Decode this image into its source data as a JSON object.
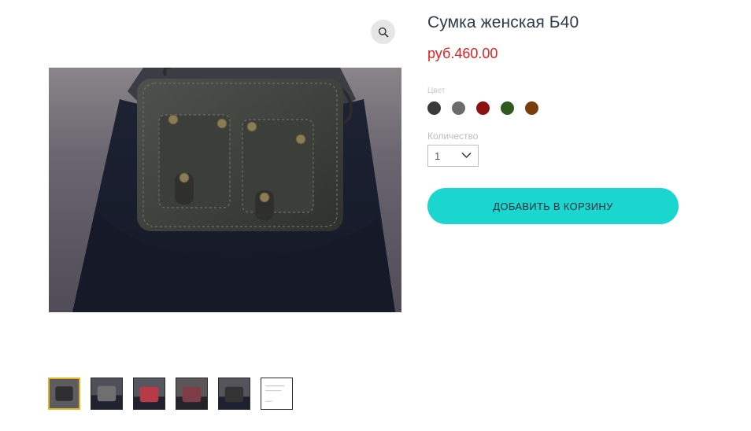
{
  "gallery": {
    "zoom_icon": "magnifier-icon",
    "thumbnails": [
      {
        "name": "thumb-black-bag",
        "selected": true,
        "bag_color": "#2f2f2f"
      },
      {
        "name": "thumb-gray-bag",
        "selected": false,
        "bag_color": "#6f6f6f"
      },
      {
        "name": "thumb-red-bag",
        "selected": false,
        "bag_color": "#b73a46"
      },
      {
        "name": "thumb-wine-bag",
        "selected": false,
        "bag_color": "#7e3c46"
      },
      {
        "name": "thumb-black-bag-2",
        "selected": false,
        "bag_color": "#333333"
      },
      {
        "name": "thumb-size-chart",
        "selected": false,
        "bag_color": "#ffffff"
      }
    ]
  },
  "product": {
    "title": "Сумка женская Б40",
    "price": "руб.460.00",
    "color_label": "Цвет",
    "colors": [
      "#3a3a3a",
      "#6b6b6b",
      "#8e1010",
      "#2e5a1e",
      "#7a3d0a"
    ],
    "quantity_label": "Количество",
    "quantity_value": "1",
    "quantity_icon": "chevron-down-icon",
    "add_to_cart_label": "ДОБАВИТЬ В КОРЗИНУ"
  },
  "colors": {
    "price": "#e02020",
    "button": "#1ad6cf",
    "selected_thumb_border": "#e0b51f"
  }
}
